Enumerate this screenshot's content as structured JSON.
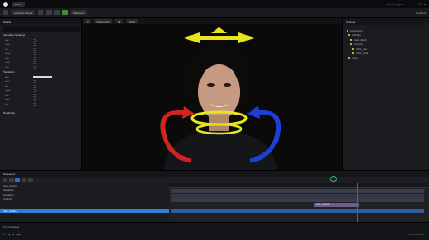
{
  "titlebar": {
    "project_tab": "Main",
    "right_label": "Unreal Engine"
  },
  "toolbar": {
    "mode_label": "Selection Mode",
    "platforms": "Platforms",
    "settings": "Settings"
  },
  "left_panel": {
    "title": "Details",
    "section1": "Animation Settings",
    "section2": "Transform",
    "section3": "Rendering"
  },
  "viewport": {
    "chip1": "Perspective",
    "chip2": "Lit",
    "chip3": "Show"
  },
  "outliner": {
    "title": "Outliner",
    "items": [
      "Atmosphere",
      "FaceRig",
      "Head_Mesh",
      "Controls",
      "CTRL_Jaw",
      "CTRL_Neck",
      "Lights"
    ]
  },
  "sequencer": {
    "title": "Sequencer",
    "tracks": [
      "Face_Control",
      "Transform",
      "Animation",
      "Controls",
      "neck_rotation"
    ],
    "selected_track": "neck_rotation",
    "clip_label": "neck_rotation"
  },
  "footer": {
    "left_text": "3 of 4 selected",
    "right_text": "Content Drawer"
  }
}
